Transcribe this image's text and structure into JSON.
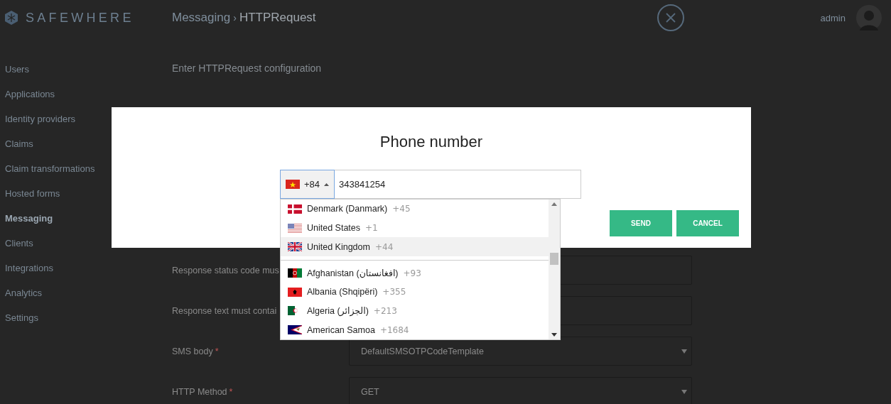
{
  "brand": {
    "name": "SAFEWHERE"
  },
  "breadcrumb": {
    "parent": "Messaging",
    "separator": "›",
    "current": "HTTPRequest"
  },
  "user": {
    "name": "admin"
  },
  "sidebar": {
    "items": [
      {
        "label": "Users",
        "selected": false
      },
      {
        "label": "Applications",
        "selected": false
      },
      {
        "label": "Identity providers",
        "selected": false
      },
      {
        "label": "Claims",
        "selected": false
      },
      {
        "label": "Claim transformations",
        "selected": false
      },
      {
        "label": "Hosted forms",
        "selected": false
      },
      {
        "label": "Messaging",
        "selected": true
      },
      {
        "label": "Clients",
        "selected": false
      },
      {
        "label": "Integrations",
        "selected": false
      },
      {
        "label": "Analytics",
        "selected": false
      },
      {
        "label": "Settings",
        "selected": false
      }
    ]
  },
  "form": {
    "heading": "Enter HTTPRequest configuration",
    "rows": [
      {
        "kind": "text",
        "label": "Response status code mus",
        "value": ""
      },
      {
        "kind": "text",
        "label": "Response text must contai",
        "value": ""
      },
      {
        "kind": "select",
        "label": "SMS body",
        "required_mark": "*",
        "value": "DefaultSMSOTPCodeTemplate"
      },
      {
        "kind": "select",
        "label": "HTTP Method",
        "required_mark": "*",
        "value": "GET"
      }
    ]
  },
  "modal": {
    "title": "Phone number",
    "phone": {
      "dial_code": "+84",
      "expanded": true,
      "value": "343841254"
    },
    "buttons": [
      "SEND",
      "CANCEL"
    ],
    "countries": [
      {
        "name": "Denmark (Danmark)",
        "dial": "+45",
        "preferred": true,
        "selected": false
      },
      {
        "name": "United States",
        "dial": "+1",
        "preferred": true,
        "selected": false
      },
      {
        "name": "United Kingdom",
        "dial": "+44",
        "preferred": true,
        "selected": true
      },
      {
        "name": "Afghanistan (افغانستان)",
        "dial": "+93",
        "preferred": false,
        "selected": false
      },
      {
        "name": "Albania (Shqipëri)",
        "dial": "+355",
        "preferred": false,
        "selected": false
      },
      {
        "name": "Algeria (الجزائر)",
        "dial": "+213",
        "preferred": false,
        "selected": false
      },
      {
        "name": "American Samoa",
        "dial": "+1684",
        "preferred": false,
        "selected": false
      }
    ]
  }
}
